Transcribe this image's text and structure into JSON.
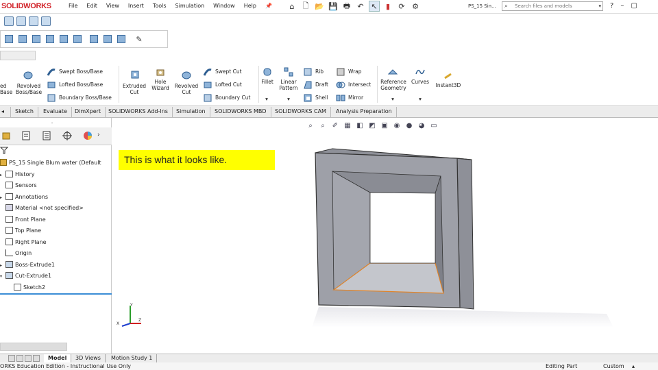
{
  "app": {
    "logo_text": "SOLIDWORKS",
    "doc_title": "PS_15 Sin...",
    "search_placeholder": "Search files and models"
  },
  "menu": [
    "File",
    "Edit",
    "View",
    "Insert",
    "Tools",
    "Simulation",
    "Window",
    "Help"
  ],
  "ribbon": {
    "left_cut": "ed\nBase",
    "revolved_boss": "Revolved\nBoss/Base",
    "swept_boss": "Swept Boss/Base",
    "lofted_boss": "Lofted Boss/Base",
    "boundary_boss": "Boundary Boss/Base",
    "extruded_cut": "Extruded\nCut",
    "hole_wizard": "Hole\nWizard",
    "revolved_cut": "Revolved\nCut",
    "swept_cut": "Swept Cut",
    "lofted_cut": "Lofted Cut",
    "boundary_cut": "Boundary Cut",
    "fillet": "Fillet",
    "linear_pattern": "Linear\nPattern",
    "rib": "Rib",
    "draft": "Draft",
    "shell": "Shell",
    "wrap": "Wrap",
    "intersect": "Intersect",
    "mirror": "Mirror",
    "reference_geometry": "Reference\nGeometry",
    "curves": "Curves",
    "instant3d": "Instant3D"
  },
  "tabs": [
    "Sketch",
    "Evaluate",
    "DimXpert",
    "SOLIDWORKS Add-Ins",
    "Simulation",
    "SOLIDWORKS MBD",
    "SOLIDWORKS CAM",
    "Analysis Preparation"
  ],
  "tree": {
    "root": "PS_15 Single Blum water (Default",
    "items": [
      "History",
      "Sensors",
      "Annotations",
      "Material <not specified>",
      "Front Plane",
      "Top Plane",
      "Right Plane",
      "Origin",
      "Boss-Extrude1",
      "Cut-Extrude1",
      "Sketch2"
    ]
  },
  "note": "This is what it looks like.",
  "bottom_tabs": [
    "Model",
    "3D Views",
    "Motion Study 1"
  ],
  "status": {
    "left": "ORKS Education Edition - Instructional Use Only",
    "editing": "Editing Part",
    "units": "Custom"
  },
  "colors": {
    "logo_red": "#d2232a",
    "note_yellow": "#ffff00",
    "model_face": "#9ea0a8",
    "edge_orange": "#e0842a",
    "tree_accent": "#3b8dd6"
  }
}
